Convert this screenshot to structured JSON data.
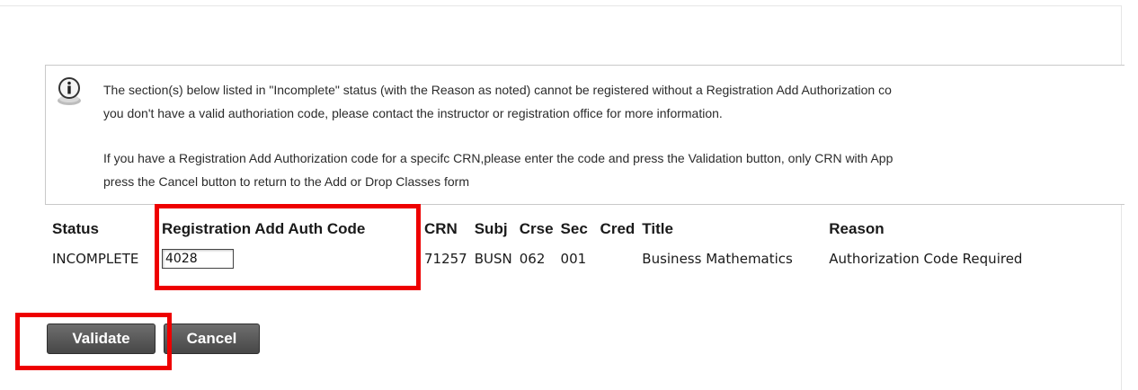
{
  "info": {
    "line1": "The section(s) below listed in \"Incomplete\" status (with the Reason as noted) cannot be registered without a Registration Add Authorization co",
    "line2": "you don't have a valid authoriation code, please contact the instructor or registration office for more information.",
    "line3": "If you have a Registration Add Authorization code for a specifc CRN,please enter the code and press the Validation button, only CRN with App",
    "line4": "press the Cancel button to return to the Add or Drop Classes form",
    "icon": "info-icon"
  },
  "table": {
    "headers": {
      "status": "Status",
      "auth": "Registration Add Auth Code",
      "crn": "CRN",
      "subj": "Subj",
      "crse": "Crse",
      "sec": "Sec",
      "cred": "Cred",
      "title": "Title",
      "reason": "Reason"
    },
    "rows": [
      {
        "status": "INCOMPLETE",
        "auth_code": "4028",
        "crn": "71257",
        "subj": "BUSN",
        "crse": "062",
        "sec": "001",
        "cred": "",
        "title": "Business Mathematics",
        "reason": "Authorization Code Required"
      }
    ]
  },
  "buttons": {
    "validate": "Validate",
    "cancel": "Cancel"
  },
  "colors": {
    "highlight": "#ee0000",
    "button": "#555555"
  }
}
